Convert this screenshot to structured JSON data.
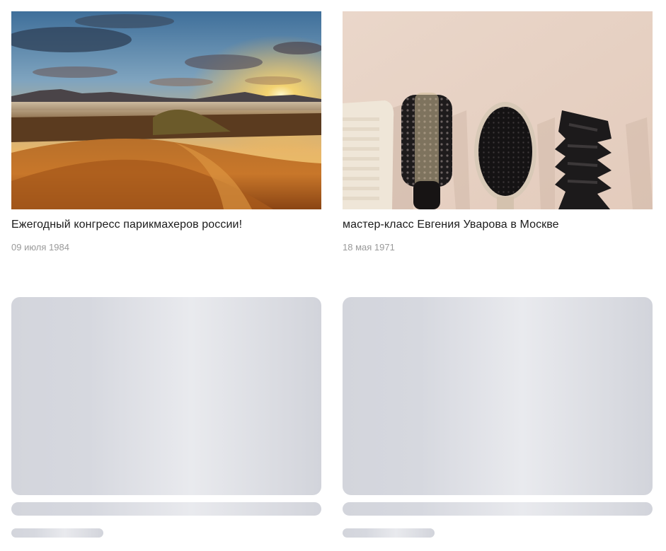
{
  "news": [
    {
      "title": "Ежегодный конгресс парикмахеров россии!",
      "date": "09 июля 1984"
    },
    {
      "title": "мастер-класс Евгения Уварова в Москве",
      "date": "18 мая 1971"
    }
  ]
}
